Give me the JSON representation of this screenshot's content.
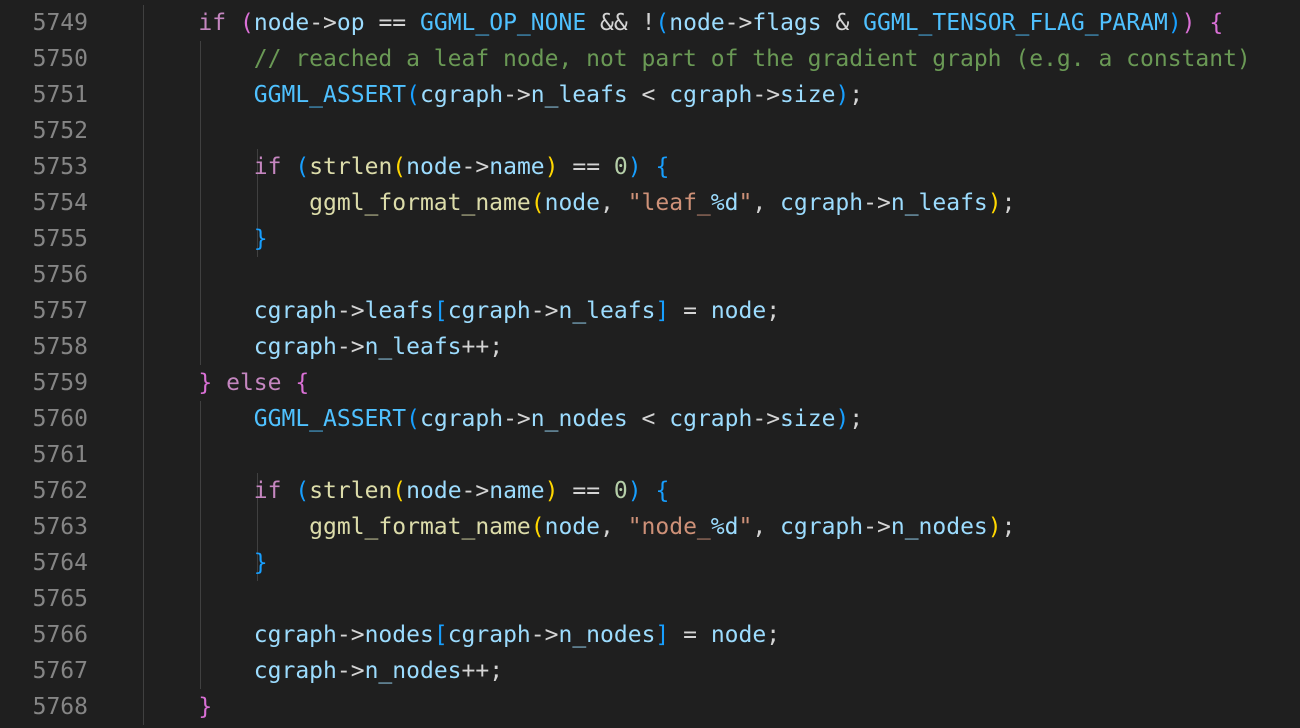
{
  "editor": {
    "line_numbers": [
      "5749",
      "5750",
      "5751",
      "5752",
      "5753",
      "5754",
      "5755",
      "5756",
      "5757",
      "5758",
      "5759",
      "5760",
      "5761",
      "5762",
      "5763",
      "5764",
      "5765",
      "5766",
      "5767",
      "5768"
    ],
    "lines": [
      [
        [
          "t",
          "    "
        ],
        [
          "kw",
          "if"
        ],
        [
          "t",
          " "
        ],
        [
          "b2",
          "("
        ],
        [
          "var",
          "node"
        ],
        [
          "op",
          "->"
        ],
        [
          "var",
          "op"
        ],
        [
          "op",
          " == "
        ],
        [
          "const",
          "GGML_OP_NONE"
        ],
        [
          "op",
          " && "
        ],
        [
          "op",
          "!"
        ],
        [
          "b3",
          "("
        ],
        [
          "var",
          "node"
        ],
        [
          "op",
          "->"
        ],
        [
          "var",
          "flags"
        ],
        [
          "op",
          " & "
        ],
        [
          "const",
          "GGML_TENSOR_FLAG_PARAM"
        ],
        [
          "b3",
          ")"
        ],
        [
          "b2",
          ")"
        ],
        [
          "t",
          " "
        ],
        [
          "b2",
          "{"
        ]
      ],
      [
        [
          "t",
          "        "
        ],
        [
          "cmt",
          "// reached a leaf node, not part of the gradient graph (e.g. a constant)"
        ]
      ],
      [
        [
          "t",
          "        "
        ],
        [
          "macro",
          "GGML_ASSERT"
        ],
        [
          "b3",
          "("
        ],
        [
          "var",
          "cgraph"
        ],
        [
          "op",
          "->"
        ],
        [
          "var",
          "n_leafs"
        ],
        [
          "op",
          " < "
        ],
        [
          "var",
          "cgraph"
        ],
        [
          "op",
          "->"
        ],
        [
          "var",
          "size"
        ],
        [
          "b3",
          ")"
        ],
        [
          "op",
          ";"
        ]
      ],
      [],
      [
        [
          "t",
          "        "
        ],
        [
          "kw",
          "if"
        ],
        [
          "t",
          " "
        ],
        [
          "b3",
          "("
        ],
        [
          "fn",
          "strlen"
        ],
        [
          "b1",
          "("
        ],
        [
          "var",
          "node"
        ],
        [
          "op",
          "->"
        ],
        [
          "var",
          "name"
        ],
        [
          "b1",
          ")"
        ],
        [
          "op",
          " == "
        ],
        [
          "num",
          "0"
        ],
        [
          "b3",
          ")"
        ],
        [
          "t",
          " "
        ],
        [
          "b3",
          "{"
        ]
      ],
      [
        [
          "t",
          "            "
        ],
        [
          "fn",
          "ggml_format_name"
        ],
        [
          "b1",
          "("
        ],
        [
          "var",
          "node"
        ],
        [
          "op",
          ", "
        ],
        [
          "str",
          "\"leaf_"
        ],
        [
          "esc",
          "%d"
        ],
        [
          "str",
          "\""
        ],
        [
          "op",
          ", "
        ],
        [
          "var",
          "cgraph"
        ],
        [
          "op",
          "->"
        ],
        [
          "var",
          "n_leafs"
        ],
        [
          "b1",
          ")"
        ],
        [
          "op",
          ";"
        ]
      ],
      [
        [
          "t",
          "        "
        ],
        [
          "b3",
          "}"
        ]
      ],
      [],
      [
        [
          "t",
          "        "
        ],
        [
          "var",
          "cgraph"
        ],
        [
          "op",
          "->"
        ],
        [
          "var",
          "leafs"
        ],
        [
          "b3",
          "["
        ],
        [
          "var",
          "cgraph"
        ],
        [
          "op",
          "->"
        ],
        [
          "var",
          "n_leafs"
        ],
        [
          "b3",
          "]"
        ],
        [
          "op",
          " = "
        ],
        [
          "var",
          "node"
        ],
        [
          "op",
          ";"
        ]
      ],
      [
        [
          "t",
          "        "
        ],
        [
          "var",
          "cgraph"
        ],
        [
          "op",
          "->"
        ],
        [
          "var",
          "n_leafs"
        ],
        [
          "op",
          "++;"
        ]
      ],
      [
        [
          "t",
          "    "
        ],
        [
          "b2",
          "}"
        ],
        [
          "t",
          " "
        ],
        [
          "kw",
          "else"
        ],
        [
          "t",
          " "
        ],
        [
          "b2",
          "{"
        ]
      ],
      [
        [
          "t",
          "        "
        ],
        [
          "macro",
          "GGML_ASSERT"
        ],
        [
          "b3",
          "("
        ],
        [
          "var",
          "cgraph"
        ],
        [
          "op",
          "->"
        ],
        [
          "var",
          "n_nodes"
        ],
        [
          "op",
          " < "
        ],
        [
          "var",
          "cgraph"
        ],
        [
          "op",
          "->"
        ],
        [
          "var",
          "size"
        ],
        [
          "b3",
          ")"
        ],
        [
          "op",
          ";"
        ]
      ],
      [],
      [
        [
          "t",
          "        "
        ],
        [
          "kw",
          "if"
        ],
        [
          "t",
          " "
        ],
        [
          "b3",
          "("
        ],
        [
          "fn",
          "strlen"
        ],
        [
          "b1",
          "("
        ],
        [
          "var",
          "node"
        ],
        [
          "op",
          "->"
        ],
        [
          "var",
          "name"
        ],
        [
          "b1",
          ")"
        ],
        [
          "op",
          " == "
        ],
        [
          "num",
          "0"
        ],
        [
          "b3",
          ")"
        ],
        [
          "t",
          " "
        ],
        [
          "b3",
          "{"
        ]
      ],
      [
        [
          "t",
          "            "
        ],
        [
          "fn",
          "ggml_format_name"
        ],
        [
          "b1",
          "("
        ],
        [
          "var",
          "node"
        ],
        [
          "op",
          ", "
        ],
        [
          "str",
          "\"node_"
        ],
        [
          "esc",
          "%d"
        ],
        [
          "str",
          "\""
        ],
        [
          "op",
          ", "
        ],
        [
          "var",
          "cgraph"
        ],
        [
          "op",
          "->"
        ],
        [
          "var",
          "n_nodes"
        ],
        [
          "b1",
          ")"
        ],
        [
          "op",
          ";"
        ]
      ],
      [
        [
          "t",
          "        "
        ],
        [
          "b3",
          "}"
        ]
      ],
      [],
      [
        [
          "t",
          "        "
        ],
        [
          "var",
          "cgraph"
        ],
        [
          "op",
          "->"
        ],
        [
          "var",
          "nodes"
        ],
        [
          "b3",
          "["
        ],
        [
          "var",
          "cgraph"
        ],
        [
          "op",
          "->"
        ],
        [
          "var",
          "n_nodes"
        ],
        [
          "b3",
          "]"
        ],
        [
          "op",
          " = "
        ],
        [
          "var",
          "node"
        ],
        [
          "op",
          ";"
        ]
      ],
      [
        [
          "t",
          "        "
        ],
        [
          "var",
          "cgraph"
        ],
        [
          "op",
          "->"
        ],
        [
          "var",
          "n_nodes"
        ],
        [
          "op",
          "++;"
        ]
      ],
      [
        [
          "t",
          "    "
        ],
        [
          "b2",
          "}"
        ]
      ]
    ],
    "guides": [
      1,
      2,
      2,
      2,
      3,
      3,
      3,
      2,
      2,
      2,
      1,
      2,
      2,
      3,
      3,
      3,
      2,
      2,
      2,
      1
    ]
  }
}
